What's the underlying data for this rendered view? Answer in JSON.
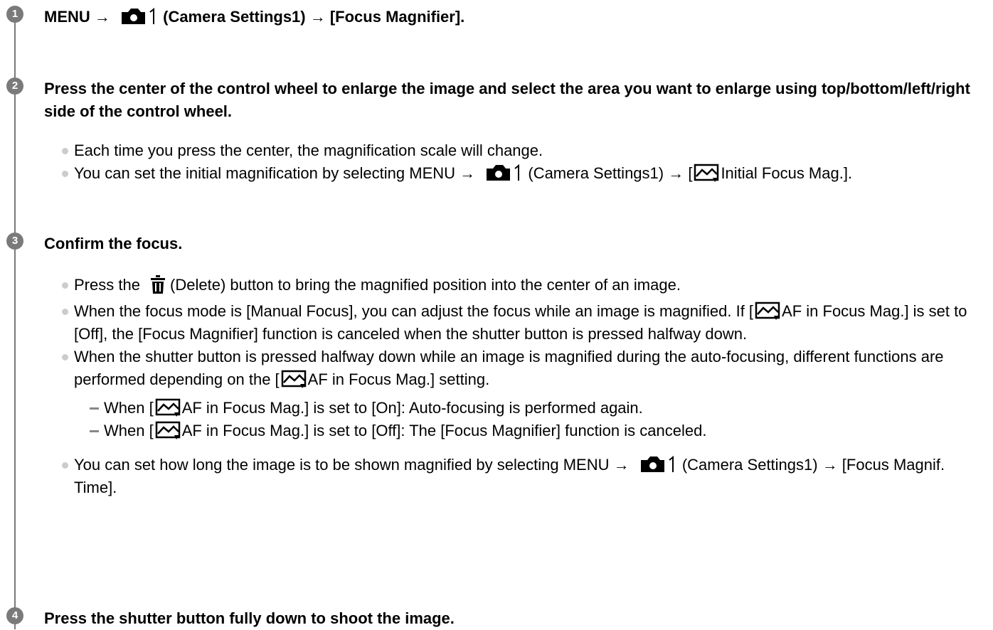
{
  "steps": [
    {
      "number": "1",
      "heading": {
        "a": "MENU → ",
        "b": " (Camera Settings1) → [Focus Magnifier]."
      }
    },
    {
      "number": "2",
      "heading": "Press the center of the control wheel to enlarge the image and select the area you want to enlarge using top/bottom/left/right side of the control wheel.",
      "bullets": [
        "Each time you press the center, the magnification scale will change.",
        {
          "a": "You can set the initial magnification by selecting MENU → ",
          "b": " (Camera Settings1) → [",
          "c": "Initial Focus Mag.]."
        }
      ]
    },
    {
      "number": "3",
      "heading": "Confirm the focus.",
      "bullets": [
        {
          "a": "Press the ",
          "b": "(Delete) button to bring the magnified position into the center of an image."
        },
        {
          "a": "When the focus mode is [Manual Focus], you can adjust the focus while an image is magnified. If [",
          "b": "AF in Focus Mag.] is set to [Off], the [Focus Magnifier] function is canceled when the shutter button is pressed halfway down."
        },
        {
          "a": "When the shutter button is pressed halfway down while an image is magnified during the auto-focusing, different functions are performed depending on the [",
          "b": "AF in Focus Mag.] setting.",
          "sub": [
            {
              "a": "When [",
              "b": "AF in Focus Mag.] is set to [On]: Auto-focusing is performed again."
            },
            {
              "a": "When [",
              "b": "AF in Focus Mag.] is set to [Off]: The [Focus Magnifier] function is canceled."
            }
          ]
        },
        {
          "a": "You can set how long the image is to be shown magnified by selecting MENU → ",
          "b": " (Camera Settings1) → [Focus Magnif. Time]."
        }
      ]
    },
    {
      "number": "4",
      "heading": "Press the shutter button fully down to shoot the image."
    }
  ],
  "icons": {
    "camera": "camera-settings1-icon",
    "magnifier": "focus-magnifier-icon",
    "delete": "trash-icon"
  },
  "colors": {
    "step_circle": "#7a7a7a",
    "bullet": "#cccccc",
    "dash": "#888888"
  }
}
